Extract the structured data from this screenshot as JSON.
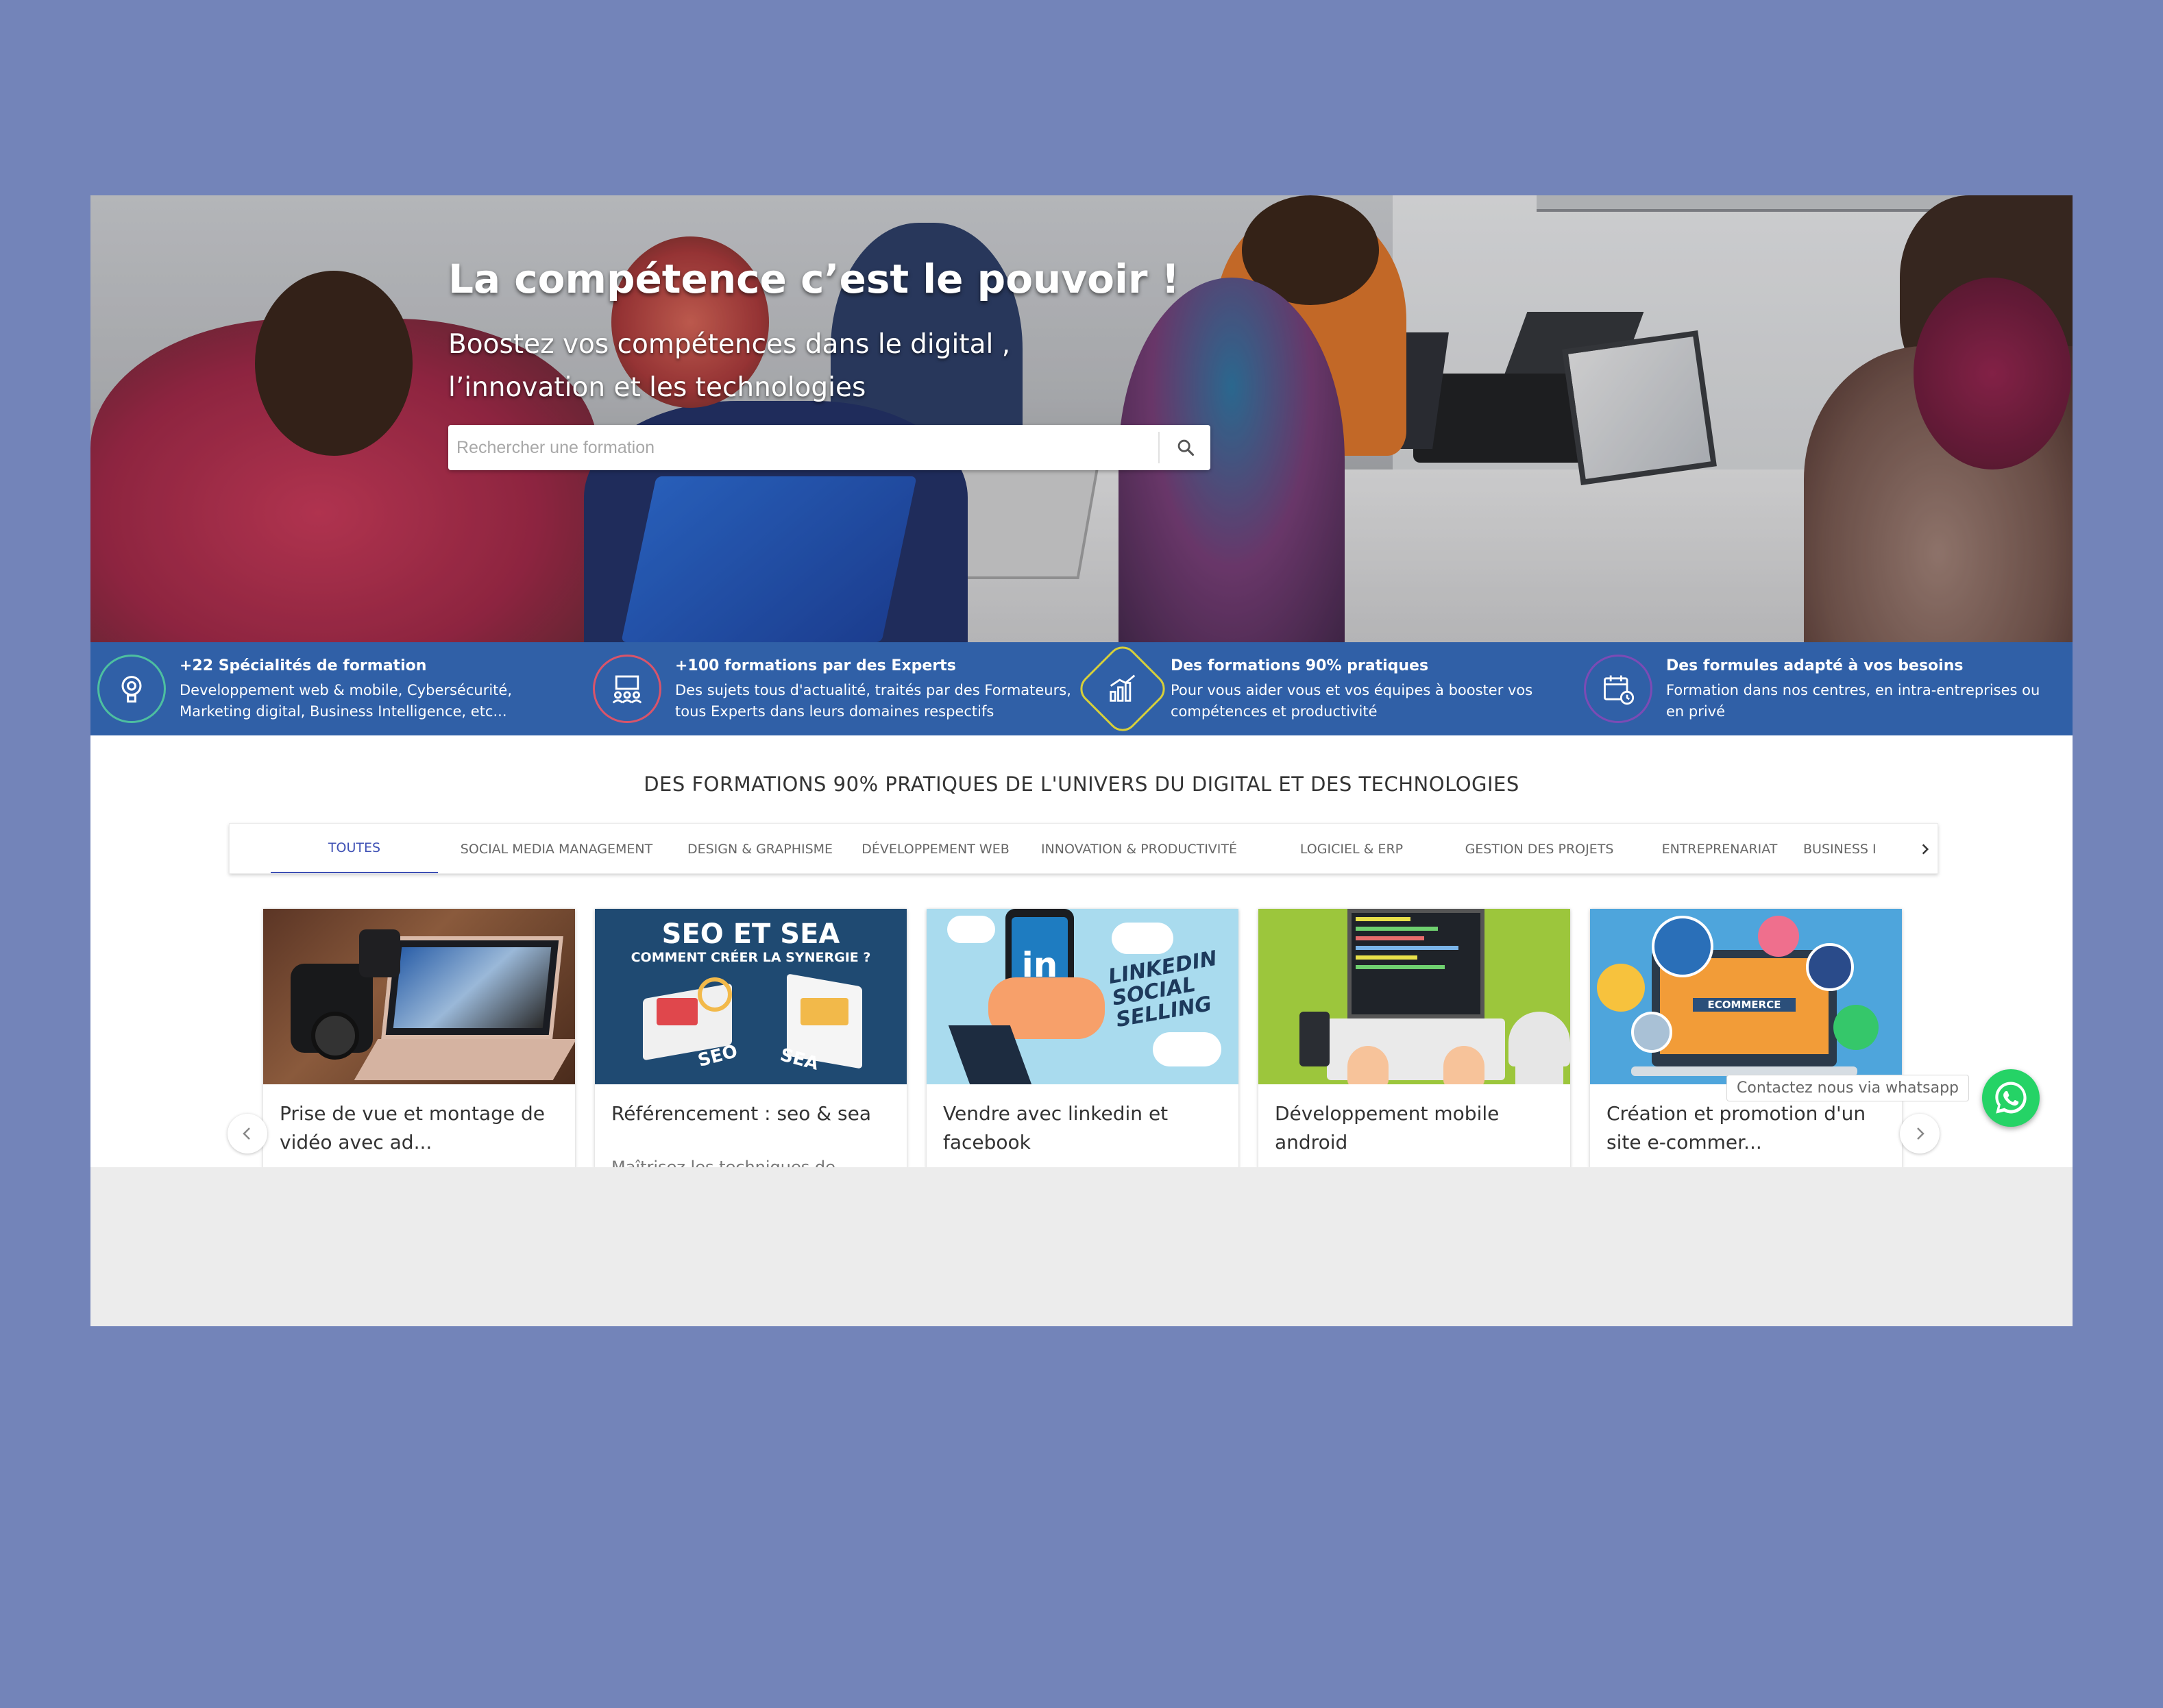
{
  "hero": {
    "title": "La compétence c’est le pouvoir !",
    "subtitle_line1": "Boostez vos compétences dans le digital ,",
    "subtitle_line2": "l’innovation et les technologies",
    "search_placeholder": "Rechercher une formation",
    "search_icon": "search-icon"
  },
  "features": [
    {
      "icon": "lightbulb-gear-icon",
      "title": "+22 Spécialités de formation",
      "line1": "Developpement web & mobile, Cybersécurité,",
      "line2": "Marketing digital, Business Intelligence, etc..."
    },
    {
      "icon": "classroom-icon",
      "title": "+100 formations par des Experts",
      "line1": "Des sujets tous d'actualité, traités par des Formateurs,",
      "line2": "tous Experts dans leurs domaines respectifs"
    },
    {
      "icon": "growth-chart-icon",
      "title": "Des formations 90% pratiques",
      "line1": "Pour vous aider vous et vos équipes à booster vos",
      "line2": "compétences et productivité"
    },
    {
      "icon": "calendar-clock-icon",
      "title": "Des formules adapté à vos besoins",
      "line1": "Formation dans nos centres, en intra-entreprises ou",
      "line2": "en privé"
    }
  ],
  "section": {
    "title": "DES FORMATIONS 90% PRATIQUES DE L'UNIVERS DU DIGITAL ET DES TECHNOLOGIES"
  },
  "tabs": [
    {
      "label": "TOUTES",
      "active": true
    },
    {
      "label": "SOCIAL MEDIA MANAGEMENT",
      "active": false
    },
    {
      "label": "DESIGN & GRAPHISME",
      "active": false
    },
    {
      "label": "DÉVELOPPEMENT WEB",
      "active": false
    },
    {
      "label": "INNOVATION & PRODUCTIVITÉ",
      "active": false
    },
    {
      "label": "LOGICIEL & ERP",
      "active": false
    },
    {
      "label": "GESTION DES PROJETS",
      "active": false
    },
    {
      "label": "ENTREPRENARIAT",
      "active": false
    },
    {
      "label": "BUSINESS I",
      "active": false
    }
  ],
  "tabs_next_icon": "chevron-right-icon",
  "cards": [
    {
      "title": "Prise de vue et montage de vidéo avec ad...",
      "description": "",
      "image": "camera-laptop-image"
    },
    {
      "title": "Référencement : seo & sea",
      "description": "Maîtrisez les techniques de",
      "image": "seo-sea-image",
      "image_title": "SEO ET SEA",
      "image_subtitle": "COMMENT CRÉER LA SYNERGIE ?",
      "image_tag1": "SEO",
      "image_tag2": "SEA"
    },
    {
      "title": "Vendre avec linkedin et facebook",
      "description": "",
      "image": "linkedin-social-selling-image",
      "image_logo": "in",
      "image_text1": "LINKEDIN",
      "image_text2": "SOCIAL",
      "image_text3": "SELLING"
    },
    {
      "title": "Développement mobile android",
      "description": "",
      "image": "android-development-image"
    },
    {
      "title": "Création et promotion d'un site e-commer...",
      "description": "",
      "image": "ecommerce-image",
      "image_label": "ECOMMERCE"
    }
  ],
  "carousel": {
    "prev_icon": "chevron-left-icon",
    "next_icon": "chevron-right-icon"
  },
  "whatsapp": {
    "label": "Contactez nous via whatsapp",
    "icon": "whatsapp-icon"
  },
  "colors": {
    "page_bg": "#7384b9",
    "feature_bar": "#3060a7",
    "active_tab": "#3f51b5",
    "whatsapp": "#25d366"
  }
}
